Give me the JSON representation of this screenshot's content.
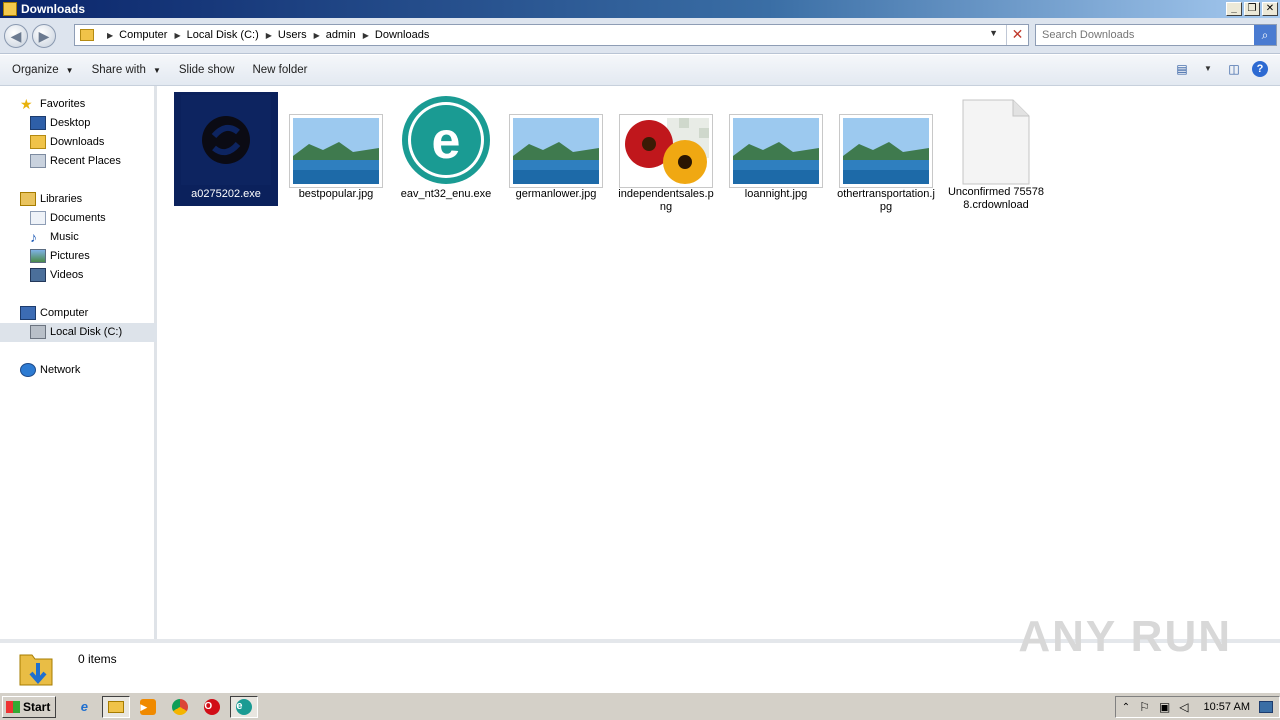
{
  "window": {
    "title": "Downloads"
  },
  "address": {
    "crumbs": [
      "Computer",
      "Local Disk (C:)",
      "Users",
      "admin",
      "Downloads"
    ],
    "search_placeholder": "Search Downloads"
  },
  "toolbar": {
    "organize": "Organize",
    "share_with": "Share with",
    "slide_show": "Slide show",
    "new_folder": "New folder"
  },
  "nav": {
    "favorites": "Favorites",
    "desktop": "Desktop",
    "downloads": "Downloads",
    "recent_places": "Recent Places",
    "libraries": "Libraries",
    "documents": "Documents",
    "music": "Music",
    "pictures": "Pictures",
    "videos": "Videos",
    "computer": "Computer",
    "local_disk": "Local Disk (C:)",
    "network": "Network"
  },
  "files": [
    {
      "name": "a0275202.exe",
      "icon": "app-s-icon",
      "selected": true
    },
    {
      "name": "bestpopular.jpg",
      "icon": "landscape-thumbnail"
    },
    {
      "name": "eav_nt32_enu.exe",
      "icon": "eset-icon"
    },
    {
      "name": "germanlower.jpg",
      "icon": "landscape-thumbnail"
    },
    {
      "name": "independentsales.png",
      "icon": "flowers-thumbnail"
    },
    {
      "name": "loannight.jpg",
      "icon": "landscape-thumbnail"
    },
    {
      "name": "othertransportation.jpg",
      "icon": "landscape-thumbnail"
    },
    {
      "name": "Unconfirmed 755788.crdownload",
      "icon": "blank-document-icon"
    }
  ],
  "status": {
    "item_count": "0 items"
  },
  "watermark": "ANY RUN",
  "taskbar": {
    "start": "Start",
    "time": "10:57 AM"
  }
}
